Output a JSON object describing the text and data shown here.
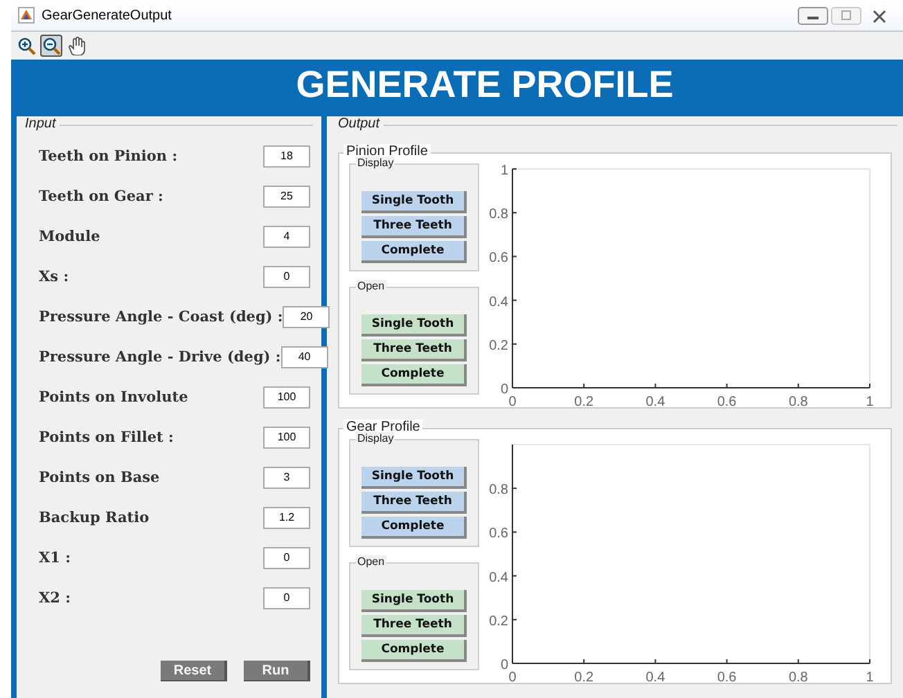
{
  "window": {
    "title": "GearGenerateOutput"
  },
  "toolbar": [
    {
      "kind": "zoom-in",
      "selected": false
    },
    {
      "kind": "zoom-out",
      "selected": true
    },
    {
      "kind": "pan",
      "selected": false
    }
  ],
  "header": {
    "title": "GENERATE PROFILE"
  },
  "input": {
    "title": "Input",
    "fields": [
      {
        "label": "Teeth on Pinion :",
        "value": "18"
      },
      {
        "label": "Teeth on Gear :",
        "value": "25"
      },
      {
        "label": "Module",
        "value": "4"
      },
      {
        "label": "Xs :",
        "value": "0"
      },
      {
        "label": "Pressure Angle - Coast (deg) :",
        "value": "20"
      },
      {
        "label": "Pressure Angle - Drive (deg) :",
        "value": "40"
      },
      {
        "label": "Points on Involute",
        "value": "100"
      },
      {
        "label": "Points on Fillet :",
        "value": "100"
      },
      {
        "label": "Points on Base",
        "value": "3"
      },
      {
        "label": "Backup Ratio",
        "value": "1.2"
      },
      {
        "label": "X1 :",
        "value": "0"
      },
      {
        "label": "X2 :",
        "value": "0"
      }
    ],
    "buttons": [
      "Reset",
      "Run"
    ]
  },
  "output": {
    "title": "Output",
    "profiles": [
      {
        "title": "Pinion Profile",
        "groups": [
          {
            "title": "Display",
            "kind": "display",
            "buttons": [
              "Single Tooth",
              "Three Teeth",
              "Complete"
            ]
          },
          {
            "title": "Open",
            "kind": "open",
            "buttons": [
              "Single Tooth",
              "Three Teeth",
              "Complete"
            ]
          }
        ],
        "axes": {
          "yticks": [
            "1",
            "0.8",
            "0.6",
            "0.4",
            "0.2",
            "0"
          ],
          "xticks": [
            "0",
            "0.2",
            "0.4",
            "0.6",
            "0.8",
            "1"
          ]
        }
      },
      {
        "title": "Gear Profile",
        "groups": [
          {
            "title": "Display",
            "kind": "display",
            "buttons": [
              "Single Tooth",
              "Three Teeth",
              "Complete"
            ]
          },
          {
            "title": "Open",
            "kind": "open",
            "buttons": [
              "Single Tooth",
              "Three Teeth",
              "Complete"
            ]
          }
        ],
        "axes": {
          "yticks": [
            "0.8",
            "0.6",
            "0.4",
            "0.2",
            "0"
          ],
          "xticks": [
            "0",
            "0.2",
            "0.4",
            "0.6",
            "0.8",
            "1"
          ]
        }
      }
    ]
  }
}
